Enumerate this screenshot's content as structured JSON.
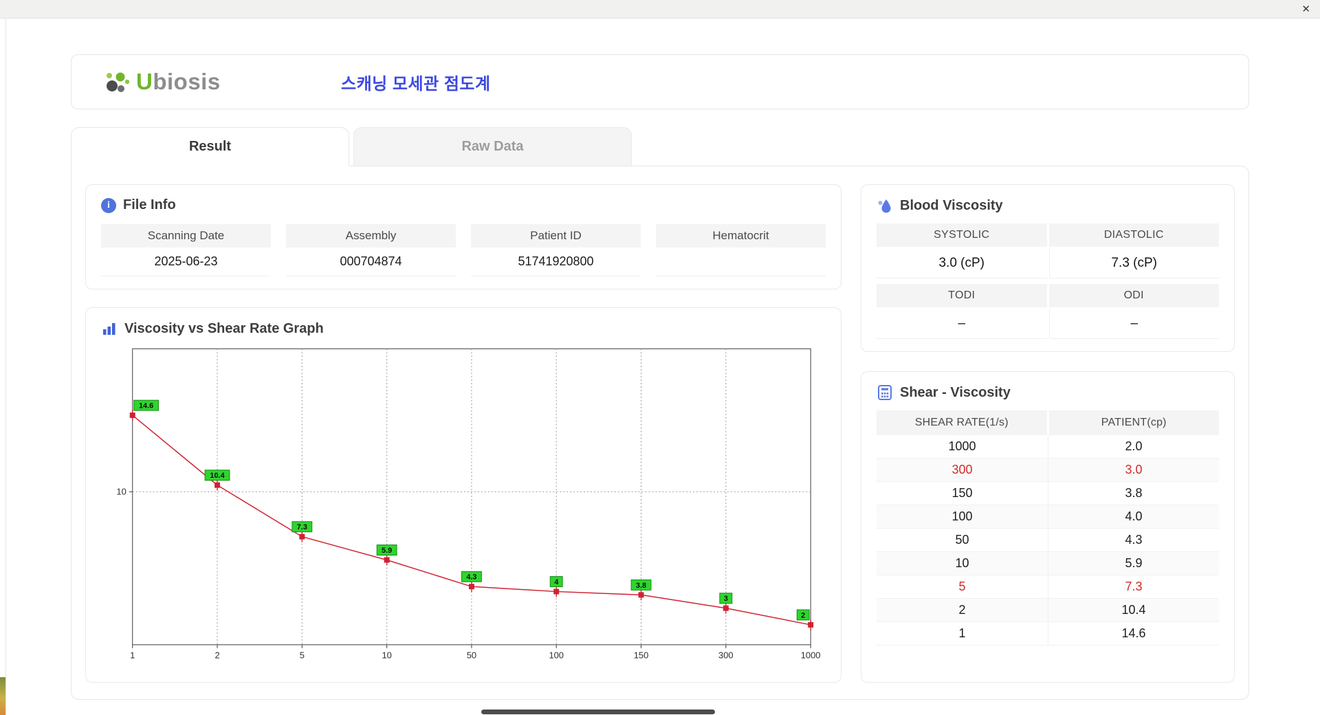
{
  "titlebar": {
    "close": "✕"
  },
  "header": {
    "logo": {
      "u": "U",
      "rest": "biosis"
    },
    "title": "스캐닝 모세관 점도계"
  },
  "tabs": [
    {
      "label": "Result",
      "active": true
    },
    {
      "label": "Raw Data",
      "active": false
    }
  ],
  "file_info": {
    "title": "File Info",
    "fields": [
      {
        "label": "Scanning Date",
        "value": "2025-06-23"
      },
      {
        "label": "Assembly",
        "value": "000704874"
      },
      {
        "label": "Patient ID",
        "value": "51741920800"
      },
      {
        "label": "Hematocrit",
        "value": ""
      }
    ]
  },
  "blood_viscosity": {
    "title": "Blood Viscosity",
    "row1": {
      "headers": [
        "SYSTOLIC",
        "DIASTOLIC"
      ],
      "values": [
        "3.0 (cP)",
        "7.3 (cP)"
      ]
    },
    "row2": {
      "headers": [
        "TODI",
        "ODI"
      ],
      "values": [
        "–",
        "–"
      ]
    }
  },
  "shear_table": {
    "title": "Shear - Viscosity",
    "headers": [
      "SHEAR RATE(1/s)",
      "PATIENT(cp)"
    ],
    "rows": [
      {
        "shear": "1000",
        "patient": "2.0",
        "highlight": false
      },
      {
        "shear": "300",
        "patient": "3.0",
        "highlight": true
      },
      {
        "shear": "150",
        "patient": "3.8",
        "highlight": false
      },
      {
        "shear": "100",
        "patient": "4.0",
        "highlight": false
      },
      {
        "shear": "50",
        "patient": "4.3",
        "highlight": false
      },
      {
        "shear": "10",
        "patient": "5.9",
        "highlight": false
      },
      {
        "shear": "5",
        "patient": "7.3",
        "highlight": true
      },
      {
        "shear": "2",
        "patient": "10.4",
        "highlight": false
      },
      {
        "shear": "1",
        "patient": "14.6",
        "highlight": false
      }
    ]
  },
  "chart_data": {
    "type": "line",
    "title": "Viscosity vs Shear Rate Graph",
    "xlabel": "",
    "ylabel": "",
    "x_scale": "category",
    "x_values": [
      1,
      2,
      5,
      10,
      50,
      100,
      150,
      300,
      1000
    ],
    "x_tick_labels": [
      "1",
      "2",
      "5",
      "10",
      "50",
      "100",
      "150",
      "300",
      "1000"
    ],
    "series": [
      {
        "name": "PATIENT(cp)",
        "values": [
          14.6,
          10.4,
          7.3,
          5.9,
          4.3,
          4.0,
          3.8,
          3.0,
          2.0
        ]
      }
    ],
    "point_labels": [
      "14.6",
      "10.4",
      "7.3",
      "5.9",
      "4.3",
      "4",
      "3.8",
      "3",
      "2"
    ],
    "y_scale": "linear",
    "y_range": [
      0.8,
      18.6
    ],
    "y_ticks": [
      10
    ],
    "grid": "dotted",
    "legend": "none",
    "line_color": "#cf2233",
    "marker_color": "#cf2233",
    "point_label_bg": "#2ed52e",
    "point_label_border": "#148a14"
  },
  "colors": {
    "title_blue": "#3c48e0",
    "logo_green": "#6fb52c",
    "icon_blue": "#4f74dc",
    "highlight_red": "#d22b2b"
  }
}
